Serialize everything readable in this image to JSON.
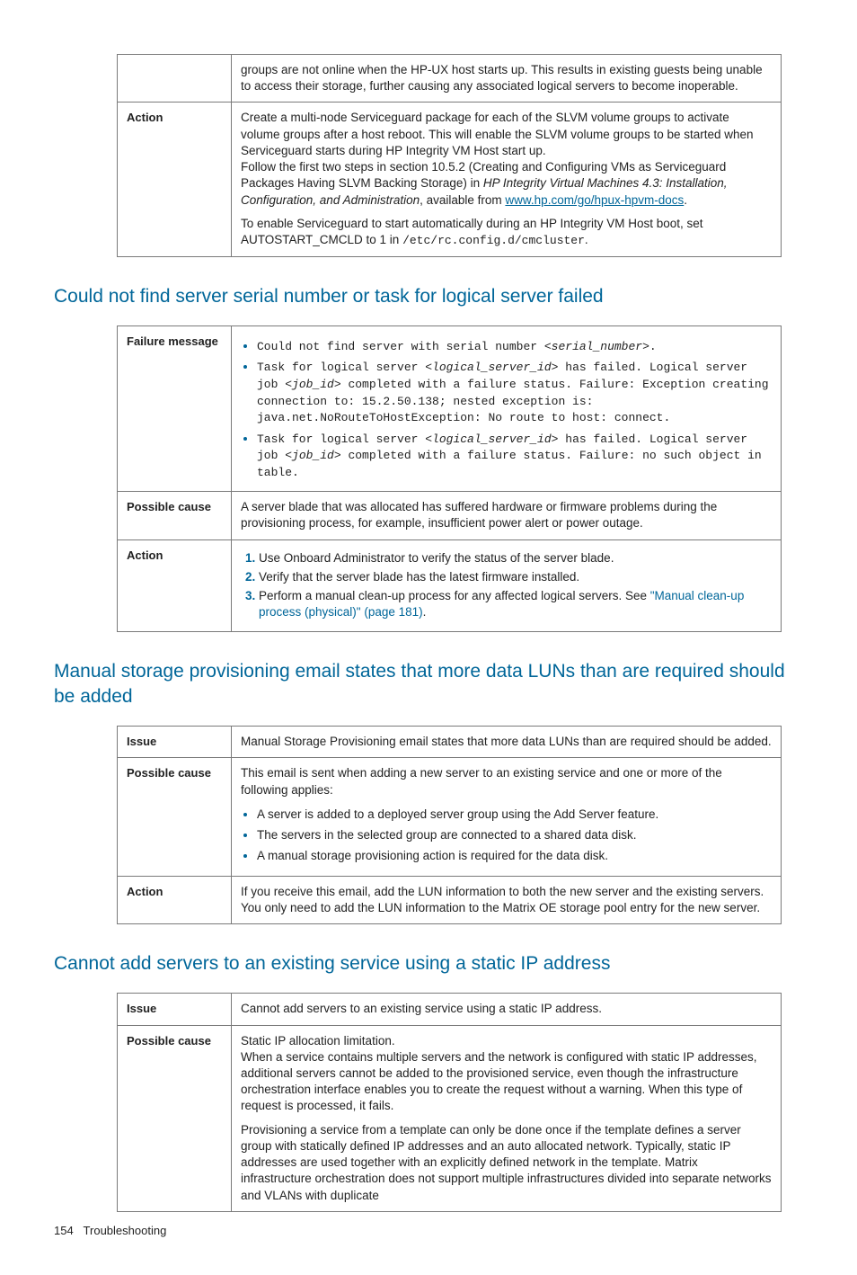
{
  "t1": {
    "r1": {
      "val": "groups are not online when the HP-UX host starts up. This results in existing guests being unable to access their storage, further causing any associated logical servers to become inoperable."
    },
    "r2": {
      "label": "Action",
      "p1a": "Create a multi-node Serviceguard package for each of the SLVM volume groups to activate volume groups after a host reboot. This will enable the SLVM volume groups to be started when Serviceguard starts during HP Integrity VM Host start up.",
      "p1b": "Follow the first two steps in section 10.5.2 (Creating and Configuring VMs as Serviceguard Packages Having SLVM Backing Storage) in ",
      "p1b_em": "HP Integrity Virtual Machines 4.3: Installation, Configuration, and Administration",
      "p1b_tail": ", available from ",
      "p1b_link": "www.hp.com/go/hpux-hpvm-docs",
      "p1b_dot": ".",
      "p2a": "To enable Serviceguard to start automatically during an HP Integrity VM Host boot, set AUTOSTART_CMCLD to 1 in ",
      "p2a_mono": "/etc/rc.config.d/cmcluster",
      "p2a_dot": "."
    }
  },
  "h1": "Could not find server serial number or task for logical server failed",
  "t2": {
    "r1": {
      "label": "Failure message",
      "b1a": "Could not find server with serial number ",
      "b1b": "<serial_number>",
      "b1c": ".",
      "b2a": "Task for logical server ",
      "b2b": "<logical_server_id>",
      "b2c": " has failed. Logical server job ",
      "b2d": "<job_id>",
      "b2e": " completed with a failure status. Failure: Exception creating connection to: 15.2.50.138; nested exception is: java.net.NoRouteToHostException: No route to host: connect.",
      "b3a": "Task for logical server ",
      "b3b": "<logical_server_id>",
      "b3c": " has failed. Logical server job ",
      "b3d": "<job_id>",
      "b3e": " completed with a failure status. Failure: no such object in table."
    },
    "r2": {
      "label": "Possible cause",
      "val": "A server blade that was allocated has suffered hardware or firmware problems during the provisioning process, for example, insufficient power alert or power outage."
    },
    "r3": {
      "label": "Action",
      "o1": "Use Onboard Administrator to verify the status of the server blade.",
      "o2": "Verify that the server blade has the latest firmware installed.",
      "o3a": "Perform a manual clean-up process for any affected logical servers. See ",
      "o3link": "\"Manual clean-up process (physical)\" (page 181)",
      "o3b": "."
    }
  },
  "h2": "Manual storage provisioning email states that more data LUNs than are required should be added",
  "t3": {
    "r1": {
      "label": "Issue",
      "val": "Manual Storage Provisioning email states that more data LUNs than are required should be added."
    },
    "r2": {
      "label": "Possible cause",
      "p1": "This email is sent when adding a new server to an existing service and one or more of the following applies:",
      "b1": "A server is added to a deployed server group using the Add Server feature.",
      "b2": "The servers in the selected group are connected to a shared data disk.",
      "b3": "A manual storage provisioning action is required for the data disk."
    },
    "r3": {
      "label": "Action",
      "val": "If you receive this email, add the LUN information to both the new server and the existing servers. You only need to add the LUN information to the Matrix OE storage pool entry for the new server."
    }
  },
  "h3": "Cannot add servers to an existing service using a static IP address",
  "t4": {
    "r1": {
      "label": "Issue",
      "val": "Cannot add servers to an existing service using a static IP address."
    },
    "r2": {
      "label": "Possible cause",
      "p1": "Static IP allocation limitation.",
      "p2": "When a service contains multiple servers and the network is configured with static IP addresses, additional servers cannot be added to the provisioned service, even though the infrastructure orchestration interface enables you to create the request without a warning. When this type of request is processed, it fails.",
      "p3": "Provisioning a service from a template can only be done once if the template defines a server group with statically defined IP addresses and an auto allocated network. Typically, static IP addresses are used together with an explicitly defined network in the template. Matrix infrastructure orchestration does not support multiple infrastructures divided into separate networks and VLANs with duplicate"
    }
  },
  "footer": {
    "page": "154",
    "title": "Troubleshooting"
  }
}
